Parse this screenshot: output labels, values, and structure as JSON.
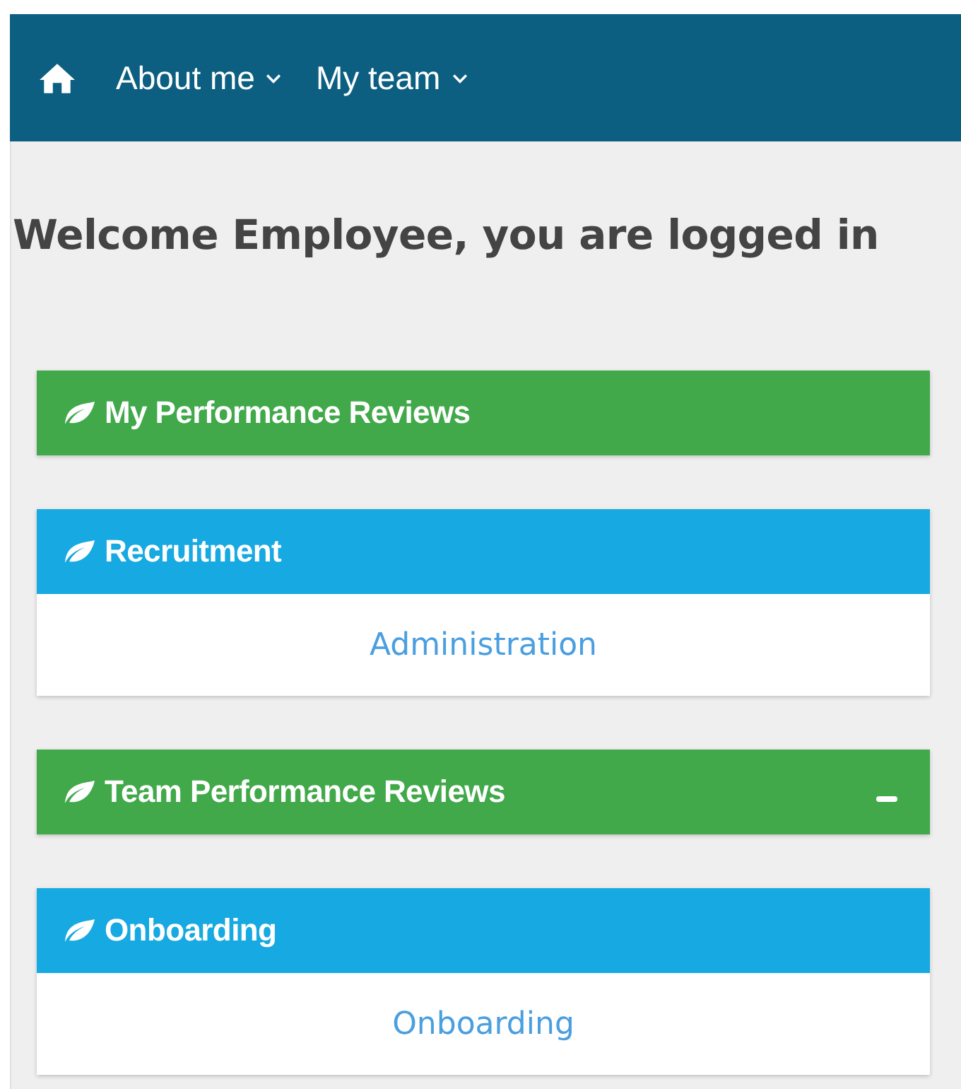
{
  "nav": {
    "items": [
      {
        "label": "About me"
      },
      {
        "label": "My team"
      }
    ]
  },
  "heading": "Welcome Employee, you are logged in",
  "panels": [
    {
      "title": "My Performance Reviews",
      "color": "#41a94a",
      "collapsible": false
    },
    {
      "title": "Recruitment",
      "color": "#17a9e1",
      "collapsible": false,
      "links": [
        "Administration"
      ]
    },
    {
      "title": "Team Performance Reviews",
      "color": "#41a94a",
      "collapsible": true
    },
    {
      "title": "Onboarding",
      "color": "#17a9e1",
      "collapsible": false,
      "links": [
        "Onboarding"
      ]
    }
  ]
}
